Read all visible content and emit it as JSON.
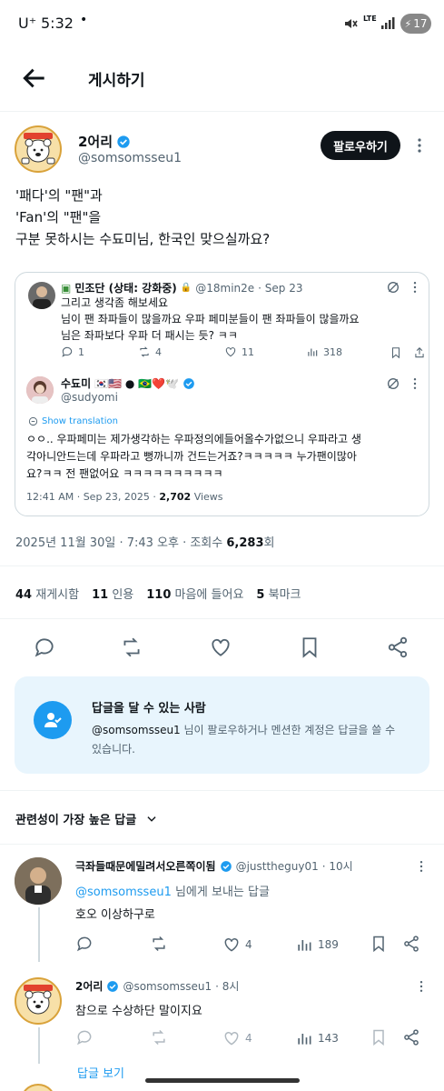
{
  "status_bar": {
    "carrier": "U⁺",
    "time": "5:32",
    "dot": "•",
    "network": "LTE",
    "battery": "17"
  },
  "header": {
    "title": "게시하기"
  },
  "author": {
    "name": "2어리",
    "handle": "@somsomsseu1",
    "follow_label": "팔로우하기"
  },
  "post": {
    "lines": [
      "'패다'의 \"팬\"과",
      "'Fan'의 \"팬\"을",
      "구분 못하시는 수됴미님, 한국인 맞으실까요?"
    ]
  },
  "quote": {
    "inner": {
      "name": "민조단 (상태: 강화중)",
      "handle": "@18min2e",
      "date": "· Sep 23",
      "lines": [
        "그리고 생각좀 해보세요",
        "님이 팬 좌파들이 많을까요 우파 페미분들이 팬 좌파들이 많을까요",
        "님은 좌파보다 우파 더 패시는 듯? ㅋㅋ"
      ],
      "replies": "1",
      "reposts": "4",
      "likes": "11",
      "views": "318"
    },
    "main": {
      "name": "수됴미",
      "flags": "🇰🇷🇺🇸 ● 🇧🇷❤️🕊️",
      "handle": "@sudyomi",
      "show_translation": "Show translation",
      "lines": [
        "ㅇㅇ.. 우파페미는 제가생각하는 우파정의에들어올수가없으니 우파라고 생",
        "각아니안드는데 우파라고 뻥까니까 건드는거죠?ㅋㅋㅋㅋㅋ 누가팬이많아",
        "요?ㅋㅋ 전 팬없어요 ㅋㅋㅋㅋㅋㅋㅋㅋㅋㅋ"
      ],
      "timestamp": "12:41 AM · Sep 23, 2025 · ",
      "views_count": "2,702",
      "views_label": " Views"
    }
  },
  "meta": {
    "datetime": "2025년 11월 30일 · 7:43 오후 · 조회수 ",
    "views": "6,283",
    "views_suffix": "회"
  },
  "stats": {
    "reposts_num": "44",
    "reposts_label": "재게시함",
    "quotes_num": "11",
    "quotes_label": "인용",
    "likes_num": "110",
    "likes_label": "마음에 들어요",
    "bookmarks_num": "5",
    "bookmarks_label": "북마크"
  },
  "callout": {
    "title": "답글을 달 수 있는 사람",
    "line1_handle": "@somsomsseu1",
    "line1_rest": " 님이 팔로우하거나 멘션한 계정은 답글을 쓸 수",
    "line2": "있습니다."
  },
  "replies_header": {
    "label": "관련성이 가장 높은 답글"
  },
  "replies": [
    {
      "name": "극좌들때문에밀려서오른쪽이됨",
      "handle": "@justtheguy01",
      "time": "· 10시",
      "reply_to_handle": "@somsomsseu1",
      "reply_to_rest": " 님에게 보내는 답글",
      "text": "호오 이상하구로",
      "reply_count": "",
      "repost_count": "",
      "like_count": "4",
      "view_count": "189"
    },
    {
      "name": "2어리",
      "handle": "@somsomsseu1",
      "time": "· 8시",
      "text": "참으로 수상하단 말이지요",
      "like_count": "4",
      "view_count": "143"
    }
  ],
  "more_replies": {
    "label": "답글 보기"
  },
  "colors": {
    "accent": "#1d9bf0",
    "text": "#0f1419",
    "muted": "#536471",
    "border": "#cfd9de",
    "callout_bg": "#e8f5fd"
  }
}
